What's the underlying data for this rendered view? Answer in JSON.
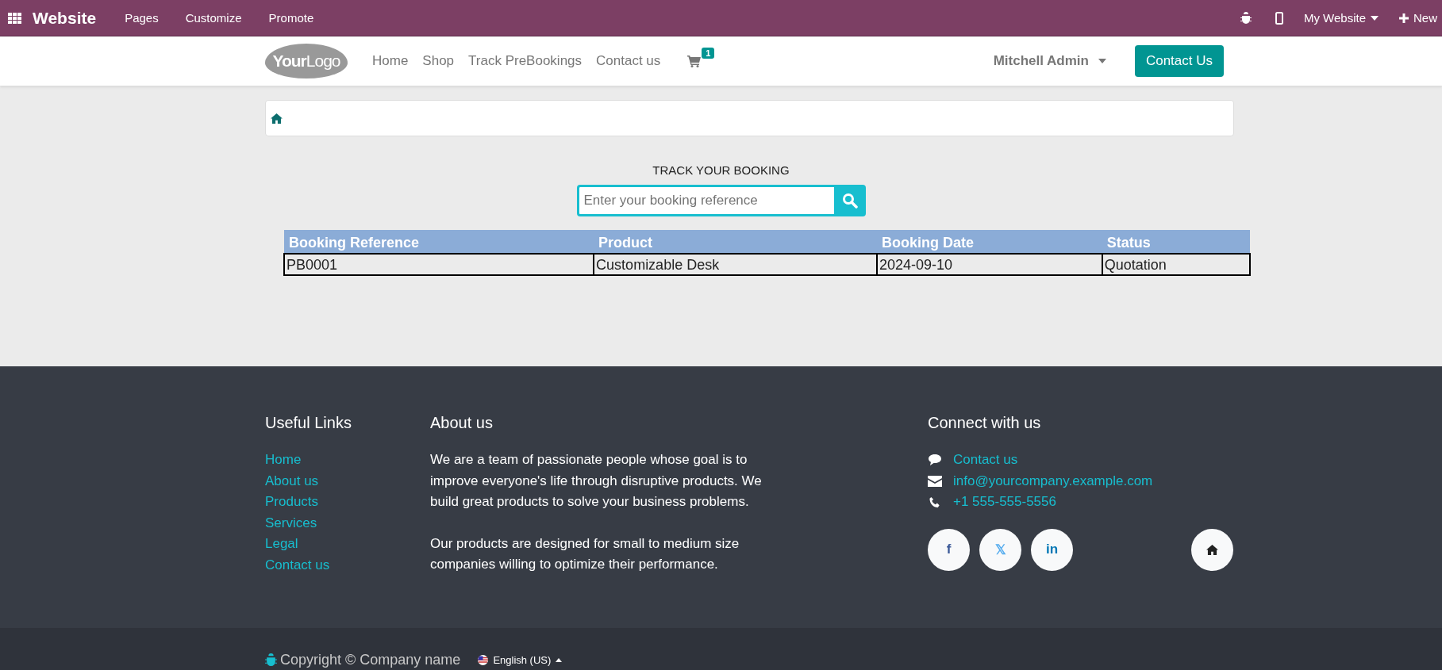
{
  "top_bar": {
    "app_name": "Website",
    "menu": [
      "Pages",
      "Customize",
      "Promote"
    ],
    "website_switcher": "My Website",
    "new_button": "New"
  },
  "header": {
    "logo": "**Your**Logo",
    "nav": [
      "Home",
      "Shop",
      "Track PreBookings",
      "Contact us"
    ],
    "cart_count": "1",
    "user": "Mitchell Admin",
    "cta": "Contact Us"
  },
  "tracker": {
    "title": "TRACK YOUR BOOKING",
    "search": {
      "placeholder": "Enter your booking reference"
    }
  },
  "table": {
    "columns": [
      "Booking Reference",
      "Product",
      "Booking Date",
      "Status"
    ],
    "rows": [
      [
        "PB0001",
        "Customizable Desk",
        "2024-09-10",
        "Quotation"
      ]
    ]
  },
  "footer": {
    "useful_links": {
      "title": "Useful Links",
      "links": [
        "Home",
        "About us",
        "Products",
        "Services",
        "Legal",
        "Contact us"
      ]
    },
    "about": {
      "title": "About us",
      "paragraphs": [
        "We are a team of passionate people whose goal is to improve everyone's life through disruptive products. We build great products to solve your business problems.",
        "Our products are designed for small to medium size companies willing to optimize their performance."
      ]
    },
    "connect": {
      "title": "Connect with us",
      "items": [
        {
          "kind": "chat",
          "text": "Contact us"
        },
        {
          "kind": "mail",
          "text": "info@yourcompany.example.com"
        },
        {
          "kind": "phone",
          "text": "+1 555-555-5556"
        }
      ],
      "social": [
        {
          "kind": "facebook",
          "text": "f"
        },
        {
          "kind": "x",
          "text": "𝕏"
        },
        {
          "kind": "linkedin",
          "text": "in"
        }
      ]
    }
  },
  "copyright": {
    "text": "Copyright © Company name",
    "language": "English (US)"
  }
}
